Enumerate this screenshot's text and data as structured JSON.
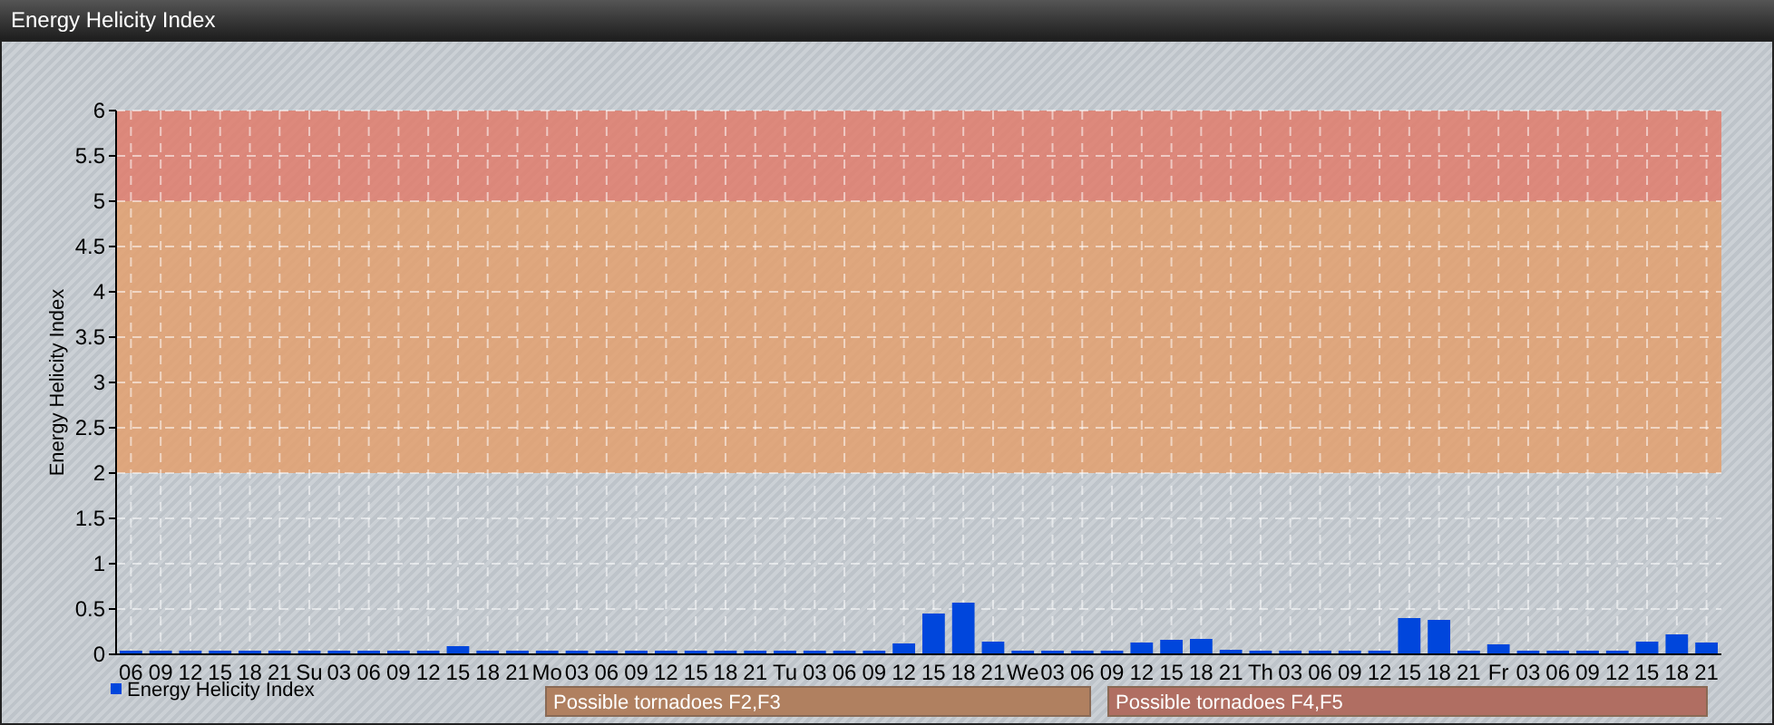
{
  "window": {
    "title": "Energy Helicity Index"
  },
  "chart": {
    "chart_data": {
      "type": "bar",
      "ylabel": "Energy Helicity Index",
      "grid": true,
      "categories": [
        "06",
        "09",
        "12",
        "15",
        "18",
        "21",
        "Su",
        "03",
        "06",
        "09",
        "12",
        "15",
        "18",
        "21",
        "Mo",
        "03",
        "06",
        "09",
        "12",
        "15",
        "18",
        "21",
        "Tu",
        "03",
        "06",
        "09",
        "12",
        "15",
        "18",
        "21",
        "We",
        "03",
        "06",
        "09",
        "12",
        "15",
        "18",
        "21",
        "Th",
        "03",
        "06",
        "09",
        "12",
        "15",
        "18",
        "21",
        "Fr",
        "03",
        "06",
        "09",
        "12",
        "15",
        "18",
        "21"
      ],
      "series": [
        {
          "name": "Energy Helicity Index",
          "color": "#0046dc",
          "values": [
            0.04,
            0.04,
            0.04,
            0.04,
            0.04,
            0.04,
            0.04,
            0.04,
            0.04,
            0.04,
            0.04,
            0.09,
            0.04,
            0.04,
            0.04,
            0.04,
            0.04,
            0.04,
            0.04,
            0.04,
            0.04,
            0.04,
            0.04,
            0.04,
            0.04,
            0.04,
            0.12,
            0.45,
            0.57,
            0.14,
            0.04,
            0.04,
            0.04,
            0.04,
            0.13,
            0.16,
            0.17,
            0.05,
            0.04,
            0.04,
            0.04,
            0.04,
            0.04,
            0.4,
            0.38,
            0.04,
            0.11,
            0.04,
            0.04,
            0.04,
            0.04,
            0.14,
            0.22,
            0.13
          ]
        }
      ],
      "ylim": [
        0,
        6
      ],
      "yticks": [
        0,
        {
          "value": 0.5,
          "label": "0.5"
        },
        1,
        {
          "value": 1.5,
          "label": "1.5"
        },
        2,
        {
          "value": 2.5,
          "label": "2.5"
        },
        3,
        {
          "value": 3.5,
          "label": "3.5"
        },
        4,
        {
          "value": 4.5,
          "label": "4.5"
        },
        5,
        {
          "value": 5.5,
          "label": "5.5"
        },
        6
      ],
      "bands": [
        {
          "axis": "y",
          "from": 2,
          "to": 5,
          "color": "#e3a06e"
        },
        {
          "axis": "y",
          "from": 5,
          "to": 6,
          "color": "#e07d6c"
        }
      ]
    },
    "risk_legend": [
      {
        "label": "Possible tornadoes F2,F3",
        "color": "#b08060"
      },
      {
        "label": "Possible tornadoes F4,F5",
        "color": "#b06e62"
      }
    ]
  }
}
